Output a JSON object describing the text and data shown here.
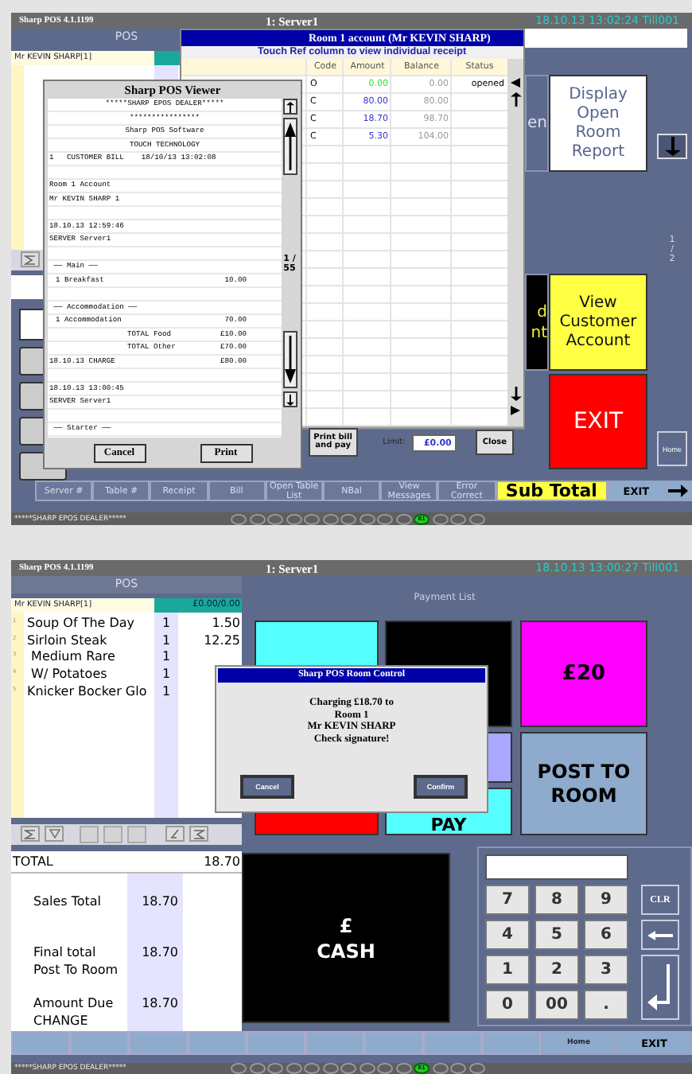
{
  "top_screen": {
    "title_bar": {
      "app": "Sharp POS 4.1.1199",
      "server": "1: Server1",
      "clock": "18.10.13  13:02:24  Till001"
    },
    "pos_header": "POS",
    "customer": "Mr KEVIN SHARP[1]",
    "partial_button_upper": {
      "label": "en"
    },
    "report_button": {
      "label": "Display Open Room Report"
    },
    "page_indicator": "1 / 2",
    "partial_button_lower": {
      "label_lines": [
        "d",
        "nt"
      ]
    },
    "customer_account_button": {
      "label": "View Customer Account"
    },
    "exit_button": {
      "label": "EXIT"
    },
    "home_button": {
      "label": "Home"
    },
    "bottom_bar": [
      {
        "kind": "key",
        "label": "Server #"
      },
      {
        "kind": "key",
        "label": "Table #"
      },
      {
        "kind": "key",
        "label": "Receipt"
      },
      {
        "kind": "key",
        "label": "Bill"
      },
      {
        "kind": "key",
        "label": "Open Table List"
      },
      {
        "kind": "key",
        "label": "NBal"
      },
      {
        "kind": "key",
        "label": "View Messages"
      },
      {
        "kind": "key",
        "label": "Error Correct"
      },
      {
        "kind": "subtotal",
        "label": "Sub Total"
      },
      {
        "kind": "exit",
        "label": "EXIT"
      },
      {
        "kind": "arrow"
      }
    ],
    "status_bar": {
      "dealer": "*****SHARP EPOS DEALER*****",
      "lamps": [
        {
          "on": false
        },
        {
          "on": false
        },
        {
          "on": false
        },
        {
          "on": false
        },
        {
          "on": false
        },
        {
          "on": false
        },
        {
          "on": false
        },
        {
          "on": false
        },
        {
          "on": false
        },
        {
          "on": false
        },
        {
          "on": true,
          "label": "81"
        },
        {
          "on": false
        },
        {
          "on": false
        },
        {
          "on": false
        }
      ]
    },
    "room_account_dialog": {
      "title": "Room 1 account (Mr KEVIN SHARP)",
      "hint": "Touch Ref column to view individual receipt",
      "columns": [
        "Code",
        "Amount",
        "Balance",
        "Status"
      ],
      "rows": [
        {
          "code": "O",
          "amount": "0.00",
          "balance": "0.00",
          "status": "opened",
          "color": "#33dd33"
        },
        {
          "code": "C",
          "amount": "80.00",
          "balance": "80.00",
          "color": "#3333cc"
        },
        {
          "code": "C",
          "amount": "18.70",
          "balance": "98.70",
          "color": "#3333cc"
        },
        {
          "code": "C",
          "amount": "5.30",
          "balance": "104.00",
          "color": "#3333cc"
        }
      ],
      "print_button": "Print bill and pay",
      "limit_label": "Limit:",
      "limit_value": "£0.00",
      "close_button": "Close"
    },
    "viewer_dialog": {
      "title": "Sharp POS Viewer",
      "lines": [
        {
          "kind": "center",
          "text": "*****SHARP EPOS DEALER*****"
        },
        {
          "kind": "center",
          "text": "****************"
        },
        {
          "kind": "center",
          "text": "Sharp POS Software"
        },
        {
          "kind": "center",
          "text": "TOUCH TECHNOLOGY"
        },
        {
          "kind": "text",
          "text": "1   CUSTOMER BILL    18/10/13 13:02:08"
        },
        {
          "kind": "blank"
        },
        {
          "kind": "text",
          "text": "Room 1 Account"
        },
        {
          "kind": "text",
          "text": "Mr KEVIN SHARP 1"
        },
        {
          "kind": "blank"
        },
        {
          "kind": "text",
          "text": "18.10.13 12:59:46"
        },
        {
          "kind": "text",
          "text": "SERVER Server1"
        },
        {
          "kind": "blank"
        },
        {
          "kind": "text",
          "text": " —— Main ——"
        },
        {
          "kind": "item",
          "text": "1 Breakfast",
          "amount": "10.00"
        },
        {
          "kind": "blank"
        },
        {
          "kind": "text",
          "text": " —— Accommodation ——"
        },
        {
          "kind": "item",
          "text": "1 Accommodation",
          "amount": "70.00"
        },
        {
          "kind": "total",
          "text": "TOTAL Food",
          "amount": "£10.00"
        },
        {
          "kind": "total",
          "text": "TOTAL Other",
          "amount": "£70.00"
        },
        {
          "kind": "item_flush",
          "text": "18.10.13 CHARGE",
          "amount": "£80.00"
        },
        {
          "kind": "blank"
        },
        {
          "kind": "text",
          "text": "18.10.13 13:00:45"
        },
        {
          "kind": "text",
          "text": "SERVER Server1"
        },
        {
          "kind": "blank"
        },
        {
          "kind": "text",
          "text": " —— Starter ——"
        }
      ],
      "page": "1 / 55",
      "cancel_button": "Cancel",
      "print_button": "Print"
    }
  },
  "bottom_screen": {
    "title_bar": {
      "app": "Sharp POS 4.1.1199",
      "server": "1: Server1",
      "clock": "18.10.13  13:00:27  Till001"
    },
    "pos_header": "POS",
    "customer": "Mr KEVIN SHARP[1]",
    "balance": "£0.00/0.00",
    "items": [
      {
        "line": "1",
        "name": "Soup Of The Day",
        "qty": "1",
        "price": "1.50"
      },
      {
        "line": "2",
        "name": "Sirloin Steak",
        "qty": "1",
        "price": "12.25"
      },
      {
        "line": "3",
        "name": " Medium Rare",
        "qty": "1"
      },
      {
        "line": "4",
        "name": " W/ Potatoes",
        "qty": "1"
      },
      {
        "line": "5",
        "name": "Knicker Bocker Glo",
        "qty": "1"
      }
    ],
    "total_label": "TOTAL",
    "total_value": "18.70",
    "totals": [
      {
        "label_lines": [
          "Sales Total"
        ],
        "value": "18.70"
      },
      {
        "label_lines": [
          "Final total",
          "Post To Room"
        ],
        "value": "18.70"
      },
      {
        "label_lines": [
          "Amount Due",
          "CHANGE"
        ],
        "value": "18.70"
      }
    ],
    "payment_list_label": "Payment List",
    "twenty_button": "£20",
    "pay_button": "PAY",
    "post_to_room_button": "POST TO ROOM",
    "cash_button": [
      "£",
      "CASH"
    ],
    "keypad": [
      {
        "kind": "digit",
        "label": "7"
      },
      {
        "kind": "digit",
        "label": "8"
      },
      {
        "kind": "digit",
        "label": "9"
      },
      {
        "kind": "clear",
        "label": "CLR"
      },
      {
        "kind": "digit",
        "label": "4"
      },
      {
        "kind": "digit",
        "label": "5"
      },
      {
        "kind": "digit",
        "label": "6"
      },
      {
        "kind": "backspace"
      },
      {
        "kind": "digit",
        "label": "1"
      },
      {
        "kind": "digit",
        "label": "2"
      },
      {
        "kind": "digit",
        "label": "3"
      },
      {
        "kind": "enter"
      },
      {
        "kind": "digit",
        "label": "0"
      },
      {
        "kind": "digit",
        "label": "00"
      },
      {
        "kind": "digit",
        "label": "."
      }
    ],
    "bottom_bar": [
      {
        "kind": "blank"
      },
      {
        "kind": "blank"
      },
      {
        "kind": "blank"
      },
      {
        "kind": "blank"
      },
      {
        "kind": "blank"
      },
      {
        "kind": "blank"
      },
      {
        "kind": "blank"
      },
      {
        "kind": "blank"
      },
      {
        "kind": "blank"
      },
      {
        "kind": "home",
        "label": "Home"
      },
      {
        "kind": "exit",
        "label": "EXIT"
      }
    ],
    "status_bar": {
      "dealer": "*****SHARP EPOS DEALER*****",
      "lamps": [
        {
          "on": false
        },
        {
          "on": false
        },
        {
          "on": false
        },
        {
          "on": false
        },
        {
          "on": false
        },
        {
          "on": false
        },
        {
          "on": false
        },
        {
          "on": false
        },
        {
          "on": false
        },
        {
          "on": false
        },
        {
          "on": true,
          "label": "81"
        },
        {
          "on": false
        },
        {
          "on": false
        },
        {
          "on": false
        }
      ]
    },
    "room_control_dialog": {
      "title": "Sharp POS Room Control",
      "message_lines": [
        "Charging £18.70 to",
        "Room 1",
        "Mr KEVIN SHARP",
        "Check signature!"
      ],
      "cancel_button": "Cancel",
      "confirm_button": "Confirm"
    }
  }
}
